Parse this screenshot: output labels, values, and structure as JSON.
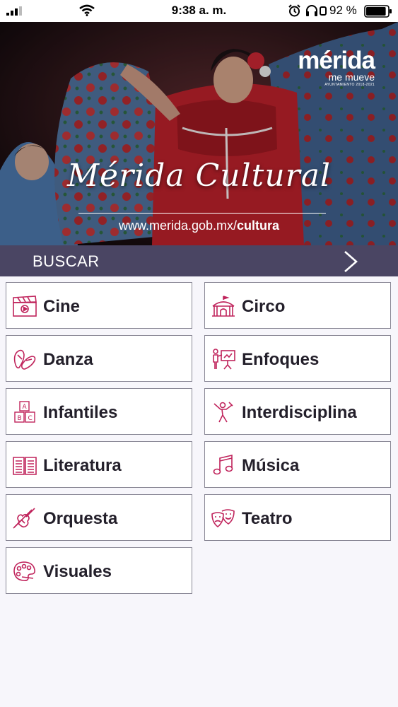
{
  "status_bar": {
    "time": "9:38 a. m.",
    "battery_percent": "92 %",
    "battery_level": 0.92,
    "icons": [
      "signal-icon",
      "wifi-icon",
      "alarm-icon",
      "headphones-icon",
      "rotation-lock-icon",
      "battery-icon"
    ]
  },
  "hero": {
    "brand_name": "mérida",
    "brand_tagline": "me mueve",
    "brand_subtitle": "AYUNTAMIENTO 2018-2021",
    "title": "Mérida Cultural",
    "url_prefix": "www.merida.gob.mx/",
    "url_bold": "cultura"
  },
  "search": {
    "label": "BUSCAR",
    "icon": "chevron-right-icon"
  },
  "categories": [
    {
      "label": "Cine",
      "icon": "film-clapper-icon"
    },
    {
      "label": "Circo",
      "icon": "circus-tent-icon"
    },
    {
      "label": "Danza",
      "icon": "dance-shoes-icon"
    },
    {
      "label": "Enfoques",
      "icon": "presentation-icon"
    },
    {
      "label": "Infantiles",
      "icon": "abc-blocks-icon"
    },
    {
      "label": "Interdisciplina",
      "icon": "performer-icon"
    },
    {
      "label": "Literatura",
      "icon": "open-book-icon"
    },
    {
      "label": "Música",
      "icon": "music-note-icon"
    },
    {
      "label": "Orquesta",
      "icon": "violin-icon"
    },
    {
      "label": "Teatro",
      "icon": "theater-masks-icon"
    },
    {
      "label": "Visuales",
      "icon": "paint-palette-icon"
    }
  ],
  "colors": {
    "accent": "#c0245c",
    "search_bar": "#4a4563",
    "card_border": "#8a8896"
  }
}
